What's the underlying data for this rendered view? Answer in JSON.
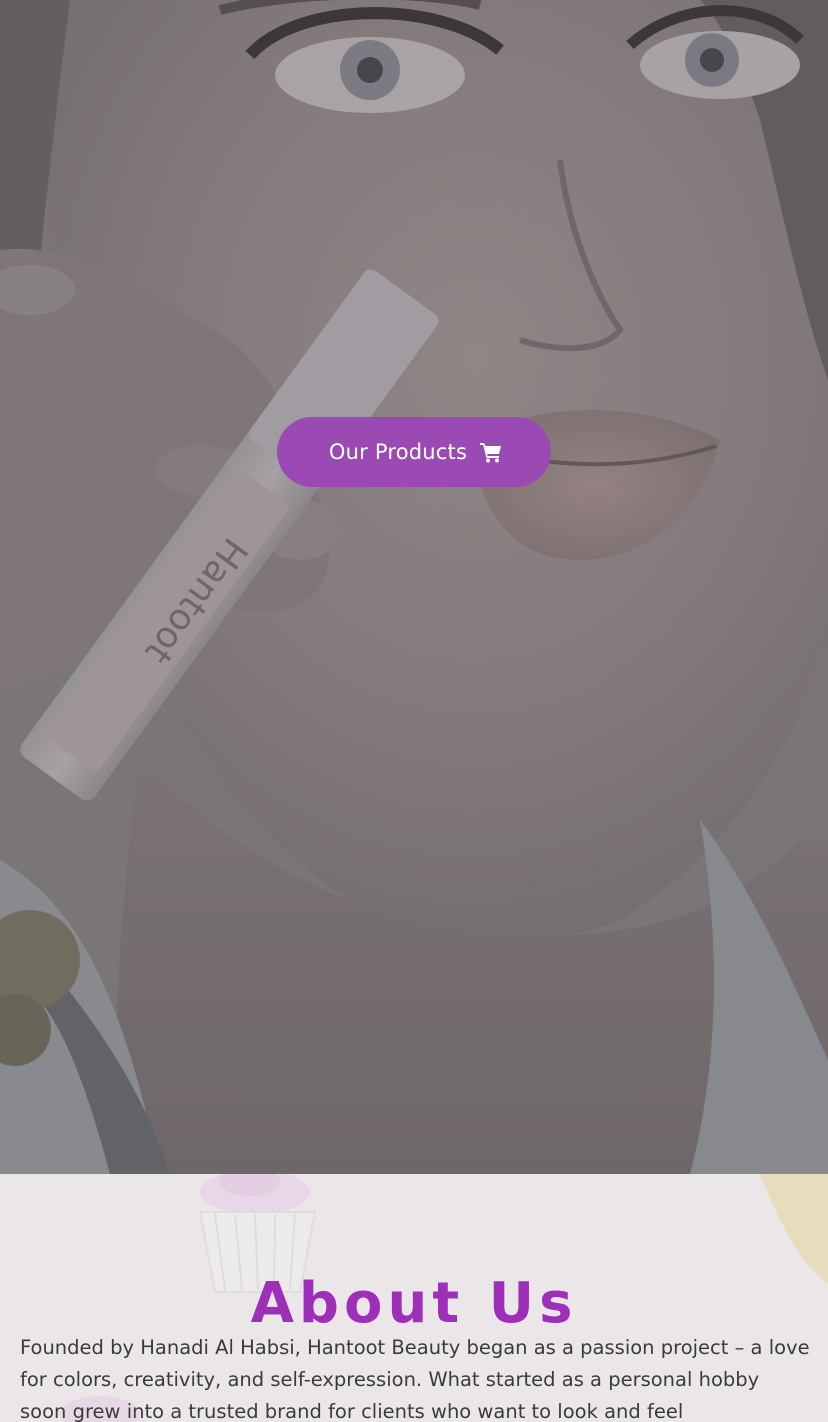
{
  "hero": {
    "cta": {
      "label": "Our Products",
      "icon": "shopping-cart-icon",
      "color": "#9b4ab3"
    },
    "product_lettering": "Hantoot"
  },
  "about": {
    "title": "About Us",
    "title_color": "#9d2fb8",
    "body": "Founded by Hanadi Al Habsi, Hantoot Beauty began as a passion project – a love for colors, creativity, and self-expression. What started as a personal hobby soon grew into a trusted brand for clients who want to look and feel"
  }
}
